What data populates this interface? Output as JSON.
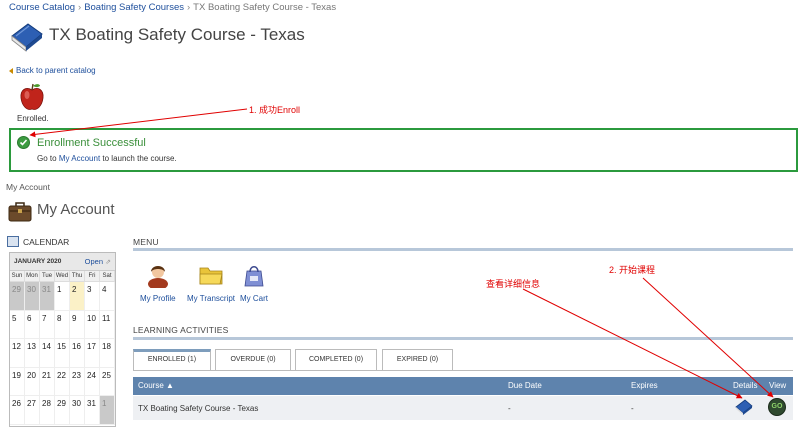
{
  "breadcrumb": {
    "items": [
      "Course Catalog",
      "Boating Safety Courses",
      "TX Boating Safety Course - Texas"
    ],
    "separator": "›"
  },
  "course": {
    "title": "TX Boating Safety Course - Texas"
  },
  "back_link": "Back to parent catalog",
  "enrolled_label": "Enrolled.",
  "success": {
    "title": "Enrollment Successful",
    "text_before": "Go to",
    "link": "My Account",
    "text_after": "to launch the course."
  },
  "my_account": {
    "small_label": "My Account",
    "title": "My Account"
  },
  "calendar": {
    "title": "CALENDAR",
    "month": "JANUARY 2020",
    "open_label": "Open",
    "weekdays": [
      "Sun",
      "Mon",
      "Tue",
      "Wed",
      "Thu",
      "Fri",
      "Sat"
    ],
    "weeks": [
      [
        "29",
        "30",
        "31",
        "1",
        "2",
        "3",
        "4"
      ],
      [
        "5",
        "6",
        "7",
        "8",
        "9",
        "10",
        "11"
      ],
      [
        "12",
        "13",
        "14",
        "15",
        "16",
        "17",
        "18"
      ],
      [
        "19",
        "20",
        "21",
        "22",
        "23",
        "24",
        "25"
      ],
      [
        "26",
        "27",
        "28",
        "29",
        "30",
        "31",
        "1"
      ]
    ]
  },
  "menu": {
    "label": "MENU",
    "items": [
      {
        "label": "My Profile",
        "icon": "profile-icon"
      },
      {
        "label": "My Transcript",
        "icon": "folder-icon"
      },
      {
        "label": "My Cart",
        "icon": "cart-icon"
      }
    ]
  },
  "learning": {
    "label": "LEARNING ACTIVITIES",
    "tabs": [
      "ENROLLED (1)",
      "OVERDUE (0)",
      "COMPLETED (0)",
      "EXPIRED (0)"
    ],
    "columns": {
      "course": "Course ▲",
      "due": "Due Date",
      "expires": "Expires",
      "details": "Details",
      "view": "View"
    },
    "rows": [
      {
        "course": "TX Boating Safety Course - Texas",
        "due": "-",
        "expires": "-",
        "view": "GO"
      }
    ]
  },
  "annotations": {
    "enroll": "1. 成功Enroll",
    "start": "2. 开始课程",
    "details": "查看详细信息"
  },
  "colors": {
    "success_border": "#2b9a3d",
    "grid_header": "#5e83ad",
    "annotation": "#e00000"
  }
}
